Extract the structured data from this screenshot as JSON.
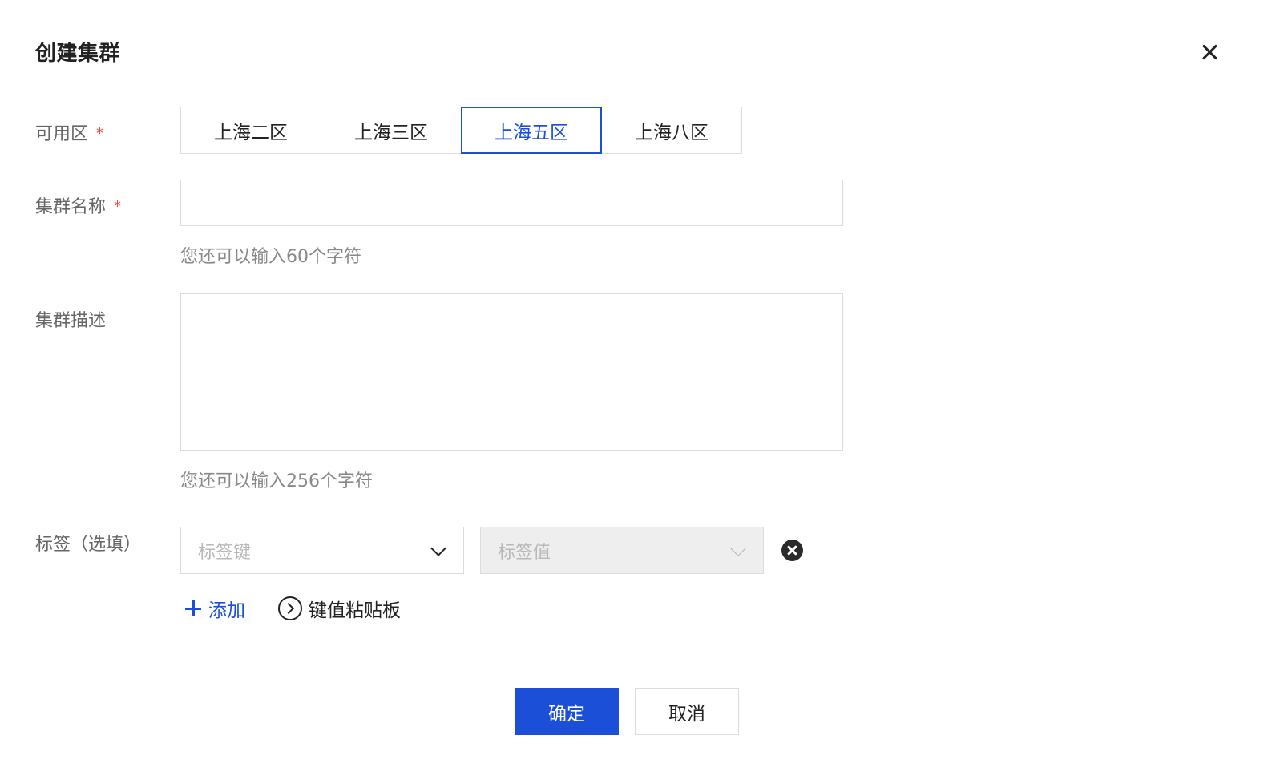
{
  "dialog": {
    "title": "创建集群"
  },
  "form": {
    "zone": {
      "label": "可用区",
      "required_mark": "*",
      "options": [
        "上海二区",
        "上海三区",
        "上海五区",
        "上海八区"
      ],
      "selected": "上海五区"
    },
    "name": {
      "label": "集群名称",
      "required_mark": "*",
      "value": "",
      "hint": "您还可以输入60个字符"
    },
    "description": {
      "label": "集群描述",
      "value": "",
      "hint": "您还可以输入256个字符"
    },
    "tags": {
      "label": "标签（选填）",
      "key_placeholder": "标签键",
      "value_placeholder": "标签值",
      "add_label": "添加",
      "paste_label": "键值粘贴板"
    }
  },
  "footer": {
    "confirm_label": "确定",
    "cancel_label": "取消"
  },
  "colors": {
    "accent": "#1c4fd8",
    "required": "#e54545",
    "border": "#dcdcdc"
  }
}
